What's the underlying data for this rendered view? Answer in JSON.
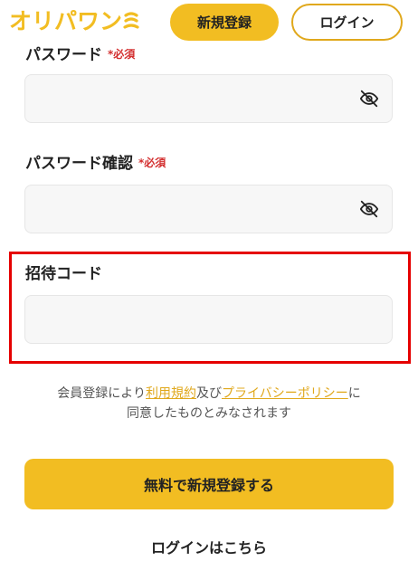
{
  "header": {
    "logo_text": "オリパワン",
    "signup_label": "新規登録",
    "login_label": "ログイン"
  },
  "form": {
    "password": {
      "label": "パスワード",
      "required": "*必須",
      "value": ""
    },
    "password_confirm": {
      "label": "パスワード確認",
      "required": "*必須",
      "value": ""
    },
    "invite_code": {
      "label": "招待コード",
      "value": ""
    }
  },
  "consent": {
    "prefix": "会員登録により",
    "terms_link": "利用規約",
    "and": "及び",
    "privacy_link": "プライバシーポリシー",
    "suffix_line1": "に",
    "line2": "同意したものとみなされます"
  },
  "submit_label": "無料で新規登録する",
  "login_link": "ログインはこちら",
  "icons": {
    "password_toggle": "eye-off-icon",
    "password_confirm_toggle": "eye-off-icon"
  },
  "colors": {
    "brand": "#f2bd22",
    "link": "#e0a81c",
    "required": "#d32f2f",
    "highlight": "#e50000",
    "input_bg": "#f7f7f7"
  }
}
